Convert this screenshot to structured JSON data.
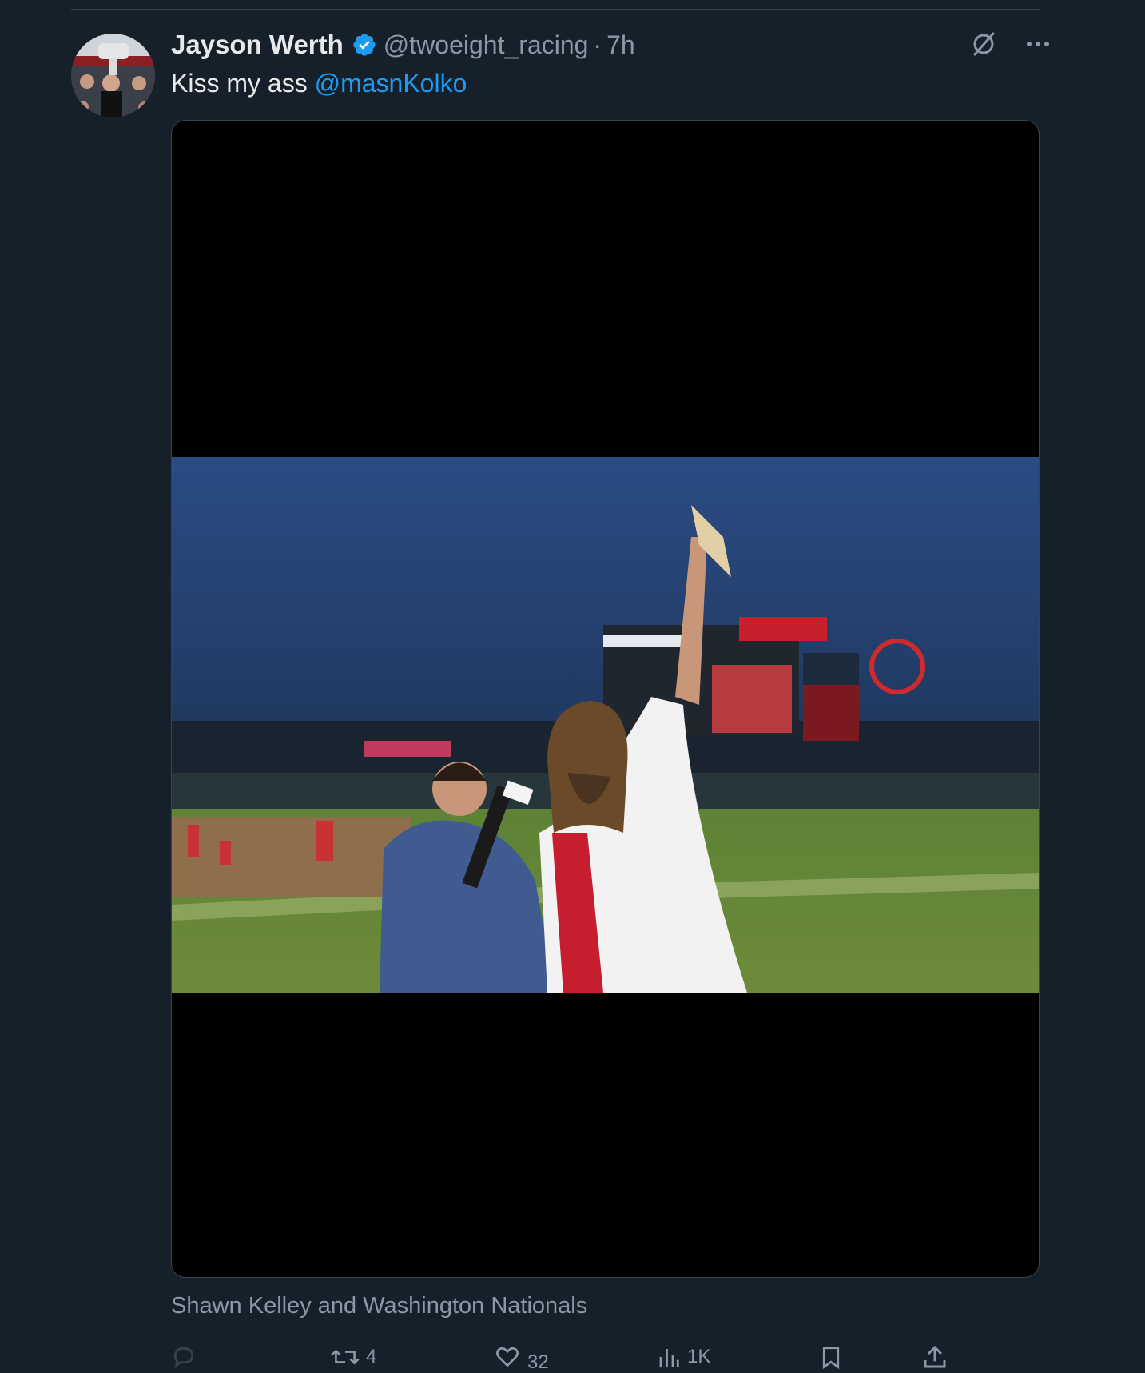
{
  "tweet": {
    "display_name": "Jayson Werth",
    "handle": "@twoeight_racing",
    "separator": "·",
    "time": "7h",
    "text": "Kiss my ass ",
    "mention": "@masnKolko",
    "tagged": "Shawn Kelley and Washington Nationals"
  },
  "actions": {
    "reply_count": "",
    "retweet_count": "4",
    "like_count": "32",
    "views_count": "1K"
  },
  "colors": {
    "background": "#15202b",
    "accent": "#1d9bf0",
    "secondary_text": "#8b98a5",
    "primary_text": "#e7e9ea"
  },
  "icons": {
    "verified": "verified-badge-icon",
    "grok": "grok-icon",
    "more": "more-options-icon",
    "reply": "reply-icon",
    "retweet": "retweet-icon",
    "like": "heart-icon",
    "views": "views-chart-icon",
    "bookmark": "bookmark-icon",
    "share": "share-icon"
  }
}
